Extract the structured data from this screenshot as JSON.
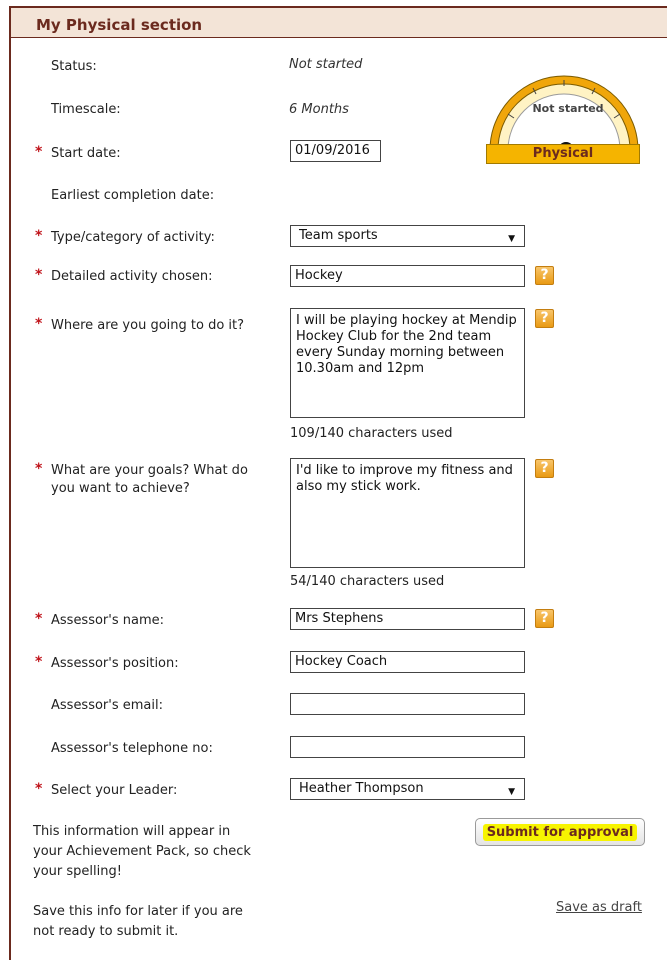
{
  "section": {
    "title": "My Physical section"
  },
  "fields": {
    "status": {
      "label": "Status:",
      "value": "Not started"
    },
    "timescale": {
      "label": "Timescale:",
      "value": "6 Months"
    },
    "start_date": {
      "label": "Start date:",
      "value": "01/09/2016"
    },
    "earliest_completion": {
      "label": "Earliest completion date:"
    },
    "activity_type": {
      "label": "Type/category of activity:",
      "value": "Team sports"
    },
    "activity_detail": {
      "label": "Detailed activity chosen:",
      "value": "Hockey"
    },
    "where": {
      "label": "Where are you going to do it?",
      "value": "I will be playing hockey at Mendip Hockey Club for the 2nd team every Sunday morning between 10.30am and 12pm",
      "counter": "109/140 characters used"
    },
    "goals": {
      "label_line1": "What are your goals? What do",
      "label_line2": "you want to achieve?",
      "value": "I'd like to improve my fitness and also my stick work.",
      "counter": "54/140 characters used"
    },
    "assessor_name": {
      "label": "Assessor's name:",
      "value": "Mrs Stephens"
    },
    "assessor_position": {
      "label": "Assessor's position:",
      "value": "Hockey Coach"
    },
    "assessor_email": {
      "label": "Assessor's email:",
      "value": ""
    },
    "assessor_phone": {
      "label": "Assessor's telephone no:",
      "value": ""
    },
    "leader": {
      "label": "Select your Leader:",
      "value": "Heather Thompson"
    }
  },
  "gauge": {
    "status_text": "Not started",
    "name": "Physical"
  },
  "help_glyph": "?",
  "required_marker": "*",
  "notes": {
    "info_line1": "This information will appear in",
    "info_line2": "your Achievement Pack, so check",
    "info_line3": "your spelling!",
    "draft_line1": "Save this info for later if you are",
    "draft_line2": "not ready to submit it."
  },
  "actions": {
    "submit_label": "Submit for approval",
    "draft_label": "Save as draft"
  },
  "colors": {
    "brand": "#6b2a1e",
    "header_bg": "#f3e4d7",
    "gauge_accent": "#f5b400",
    "required": "#c0141b",
    "highlight": "#f7f400"
  }
}
